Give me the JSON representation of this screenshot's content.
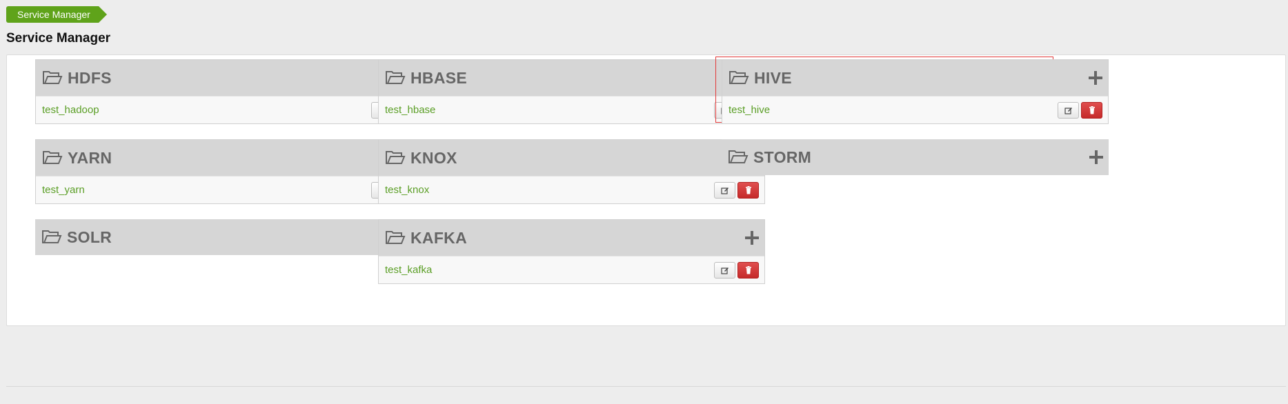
{
  "breadcrumb": {
    "label": "Service Manager"
  },
  "page_title": "Service Manager",
  "colors": {
    "accent_green": "#5fa31a",
    "link_green": "#5a9e25",
    "delete_red": "#c52a2a",
    "highlight_red": "#e23a3a"
  },
  "services": [
    {
      "name": "HDFS",
      "repositories": [
        "test_hadoop"
      ],
      "highlighted": false
    },
    {
      "name": "HBASE",
      "repositories": [
        "test_hbase"
      ],
      "highlighted": false
    },
    {
      "name": "HIVE",
      "repositories": [
        "test_hive"
      ],
      "highlighted": true
    },
    {
      "name": "YARN",
      "repositories": [
        "test_yarn"
      ],
      "highlighted": false
    },
    {
      "name": "KNOX",
      "repositories": [
        "test_knox"
      ],
      "highlighted": false
    },
    {
      "name": "STORM",
      "repositories": [],
      "highlighted": false
    },
    {
      "name": "SOLR",
      "repositories": [],
      "highlighted": false
    },
    {
      "name": "KAFKA",
      "repositories": [
        "test_kafka"
      ],
      "highlighted": false
    }
  ],
  "icons": {
    "folder": "folder-open-icon",
    "add": "plus-icon",
    "edit": "edit-icon",
    "delete": "trash-icon"
  }
}
